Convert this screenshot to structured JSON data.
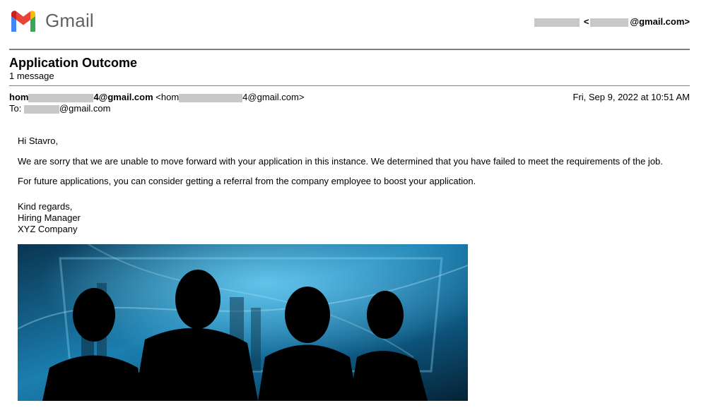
{
  "app": {
    "name": "Gmail"
  },
  "account": {
    "open": "<",
    "domain": "@gmail.com>"
  },
  "thread": {
    "subject": "Application Outcome",
    "count": "1 message"
  },
  "message": {
    "from_prefix": "hom",
    "from_suffix": "4@gmail.com",
    "from_addr_prefix": " <hom",
    "from_addr_suffix": "4@gmail.com>",
    "date": "Fri, Sep 9, 2022 at 10:51 AM",
    "to_label": "To: ",
    "to_suffix": "@gmail.com",
    "greeting": "Hi Stavro,",
    "para1": "We are sorry that we are unable to move forward with your application in this instance. We determined that you have failed to meet the requirements of the job.",
    "para2": "For future applications, you can consider getting a referral from the company employee to boost your application.",
    "sign1": "Kind regards,",
    "sign2": "Hiring Manager",
    "sign3": "XYZ Company"
  },
  "colors": {
    "rule": "#7f7f7f",
    "redaction": "#c8c8c8",
    "brand_text": "#5f6368"
  }
}
